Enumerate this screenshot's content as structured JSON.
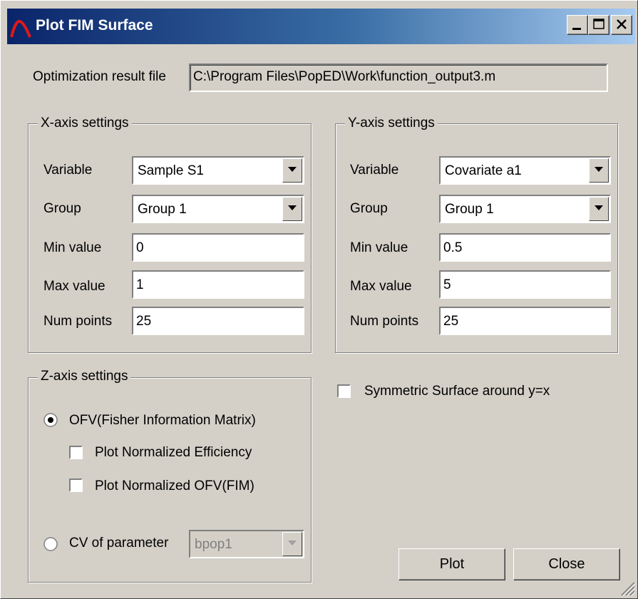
{
  "window": {
    "title": "Plot FIM Surface",
    "buttons": [
      "minimize",
      "maximize",
      "close"
    ]
  },
  "result_file": {
    "label": "Optimization result file",
    "value": "C:\\Program Files\\PopED\\Work\\function_output3.m"
  },
  "x_axis": {
    "title": "X-axis settings",
    "variable_label": "Variable",
    "variable_value": "Sample S1",
    "group_label": "Group",
    "group_value": "Group 1",
    "min_label": "Min value",
    "min_value": "0",
    "max_label": "Max value",
    "max_value": "1",
    "points_label": "Num points",
    "points_value": "25"
  },
  "y_axis": {
    "title": "Y-axis settings",
    "variable_label": "Variable",
    "variable_value": "Covariate a1",
    "group_label": "Group",
    "group_value": "Group 1",
    "min_label": "Min value",
    "min_value": "0.5",
    "max_label": "Max value",
    "max_value": "5",
    "points_label": "Num points",
    "points_value": "25"
  },
  "z_axis": {
    "title": "Z-axis settings",
    "ofv_label": "OFV(Fisher Information Matrix)",
    "ofv_selected": true,
    "norm_eff_label": "Plot Normalized Efficiency",
    "norm_eff_checked": false,
    "norm_ofv_label": "Plot Normalized OFV(FIM)",
    "norm_ofv_checked": false,
    "cv_label": "CV of parameter",
    "cv_selected": false,
    "cv_param_value": "bpop1",
    "cv_param_disabled": true
  },
  "symmetric": {
    "label": "Symmetric Surface around y=x",
    "checked": false
  },
  "actions": {
    "plot_label": "Plot",
    "close_label": "Close"
  },
  "colors": {
    "title_start": "#0a246a",
    "title_end": "#a6caf0",
    "face": "#d4d0c8",
    "icon_red": "#e01818"
  }
}
